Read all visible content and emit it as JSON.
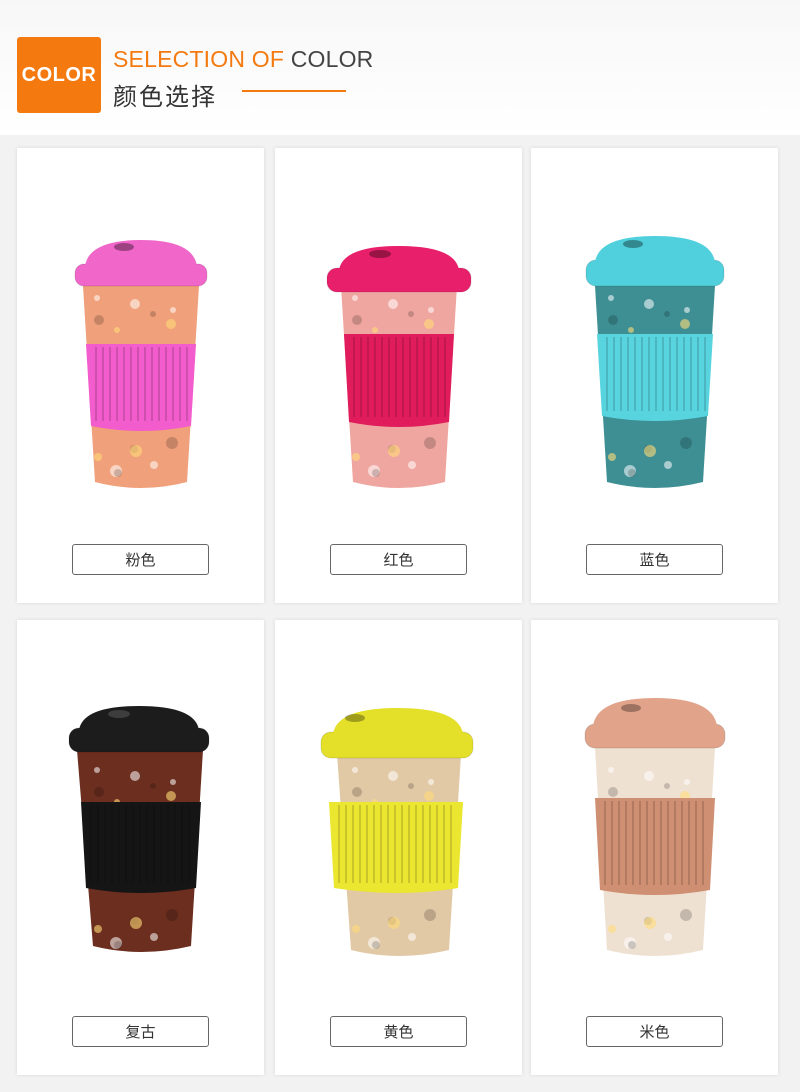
{
  "header": {
    "badge": "COLOR",
    "title_en_highlight": "SELECTION OF",
    "title_en_rest": "COLOR",
    "title_cn": "颜色选择",
    "accent_color": "#f47a10"
  },
  "products": [
    {
      "label": "粉色",
      "lid_color": "#f066c9",
      "sleeve_color": "#f25ccc",
      "body_color": "#f0a07a",
      "pattern_icon": "fox-floral-pattern-icon"
    },
    {
      "label": "红色",
      "lid_color": "#e81f6a",
      "sleeve_color": "#e01c5c",
      "body_color": "#f0a6a0",
      "pattern_icon": "girl-bird-pattern-icon"
    },
    {
      "label": "蓝色",
      "lid_color": "#4fd0dc",
      "sleeve_color": "#58d4df",
      "body_color": "#3e8f94",
      "pattern_icon": "forest-animal-pattern-icon"
    },
    {
      "label": "复古",
      "lid_color": "#1c1c1c",
      "sleeve_color": "#151515",
      "body_color": "#6b2e1f",
      "pattern_icon": "dungeons-pattern-icon"
    },
    {
      "label": "黄色",
      "lid_color": "#e4e02a",
      "sleeve_color": "#ebe630",
      "body_color": "#e2c9a6",
      "pattern_icon": "jungle-animal-pattern-icon"
    },
    {
      "label": "米色",
      "lid_color": "#e1a48b",
      "sleeve_color": "#cf8f72",
      "body_color": "#efe1d2",
      "pattern_icon": "palm-tree-pattern-icon"
    }
  ]
}
